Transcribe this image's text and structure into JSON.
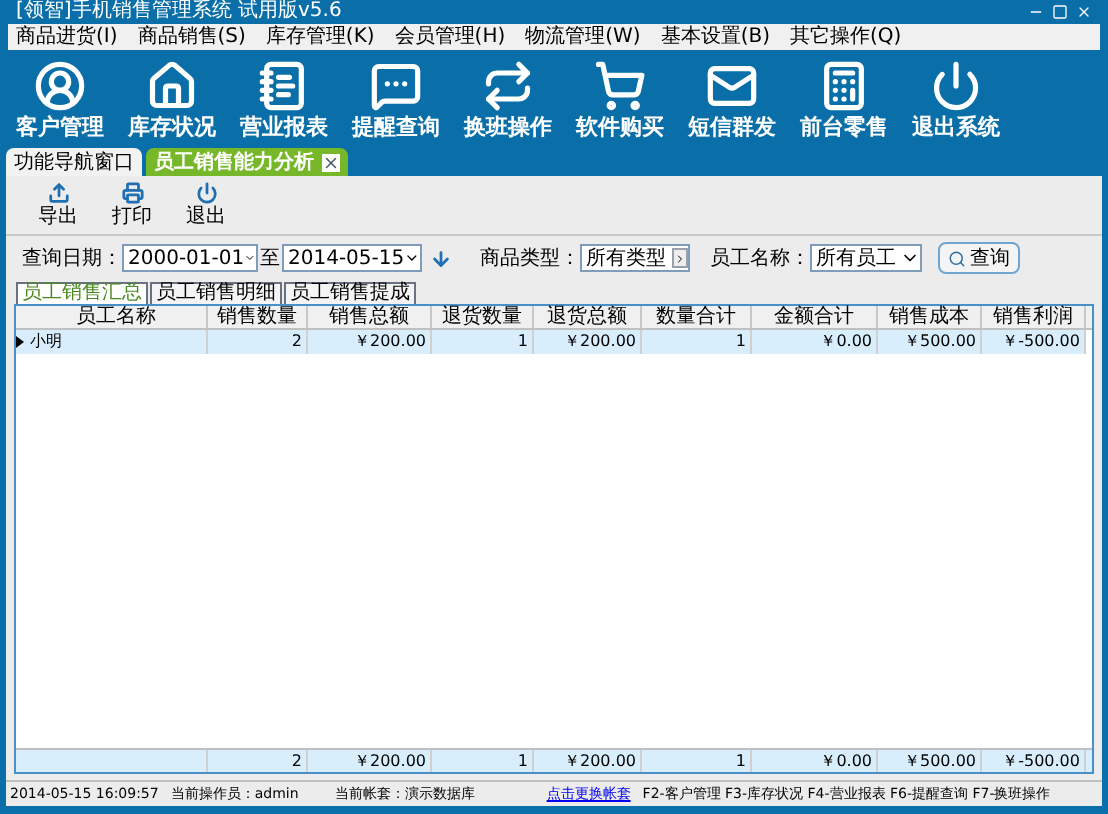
{
  "window": {
    "title": "[领智]手机销售管理系统 试用版v5.6"
  },
  "menu": [
    "商品进货(I)",
    "商品销售(S)",
    "库存管理(K)",
    "会员管理(H)",
    "物流管理(W)",
    "基本设置(B)",
    "其它操作(Q)"
  ],
  "toolbar": [
    "客户管理",
    "库存状况",
    "营业报表",
    "提醒查询",
    "换班操作",
    "软件购买",
    "短信群发",
    "前台零售",
    "退出系统"
  ],
  "tabs": [
    {
      "label": "功能导航窗口",
      "selected": false,
      "closable": false
    },
    {
      "label": "员工销售能力分析",
      "selected": true,
      "closable": true
    }
  ],
  "actions": [
    "导出",
    "打印",
    "退出"
  ],
  "filters": {
    "date_label": "查询日期：",
    "date_from": "2000-01-01",
    "date_sep": "至",
    "date_to": "2014-05-15",
    "category_label": "商品类型：",
    "category": "所有类型",
    "employee_label": "员工名称：",
    "employee": "所有员工",
    "query_button": "查询"
  },
  "subtabs": [
    {
      "label": "员工销售汇总",
      "selected": true
    },
    {
      "label": "员工销售明细",
      "selected": false
    },
    {
      "label": "员工销售提成",
      "selected": false
    }
  ],
  "table": {
    "columns": [
      "员工名称",
      "销售数量",
      "销售总额",
      "退货数量",
      "退货总额",
      "数量合计",
      "金额合计",
      "销售成本",
      "销售利润"
    ],
    "rows": [
      {
        "selected": true,
        "cells": [
          "小明",
          "2",
          "￥200.00",
          "1",
          "￥200.00",
          "1",
          "￥0.00",
          "￥500.00",
          "￥-500.00"
        ]
      }
    ],
    "totals": [
      "2",
      "￥200.00",
      "1",
      "￥200.00",
      "1",
      "￥0.00",
      "￥500.00",
      "￥-500.00"
    ]
  },
  "status_bar": {
    "time": "2014-05-15 16:09:57",
    "operator": "当前操作员：admin",
    "account": "当前帐套：演示数据库",
    "switch_link": "点击更换帐套",
    "shortcuts": "F2-客户管理 F3-库存状况 F4-营业报表 F6-提醒查询 F7-换班操作"
  }
}
